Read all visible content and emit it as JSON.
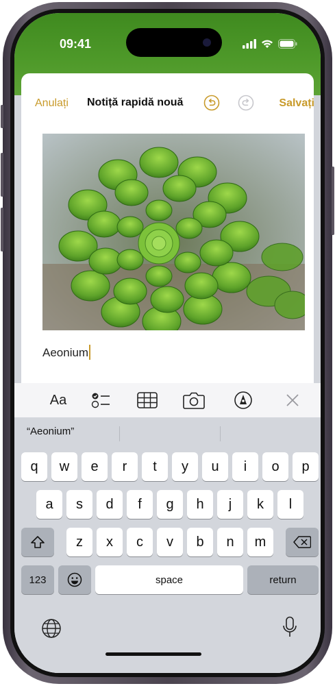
{
  "status": {
    "time": "09:41"
  },
  "nav": {
    "cancel_label": "Anulați",
    "title": "Notiță rapidă nouă",
    "save_label": "Salvați"
  },
  "note": {
    "text": "Aeonium"
  },
  "toolbar": {
    "format_label": "Aa"
  },
  "keyboard": {
    "suggestions": [
      "“Aeonium”",
      "",
      ""
    ],
    "row1": [
      "q",
      "w",
      "e",
      "r",
      "t",
      "y",
      "u",
      "i",
      "o",
      "p"
    ],
    "row2": [
      "a",
      "s",
      "d",
      "f",
      "g",
      "h",
      "j",
      "k",
      "l"
    ],
    "row3": [
      "z",
      "x",
      "c",
      "v",
      "b",
      "n",
      "m"
    ],
    "numbers_label": "123",
    "space_label": "space",
    "return_label": "return"
  },
  "colors": {
    "accent": "#c89a2a",
    "status_green": "#4f9a2a"
  }
}
